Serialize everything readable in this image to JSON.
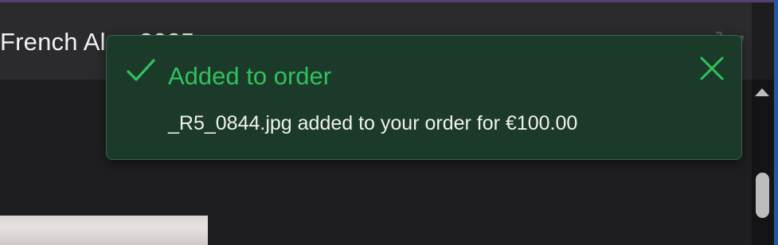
{
  "header": {
    "gallery_title": "French Alps 2025"
  },
  "icons": {
    "cart": "cart-icon",
    "check": "check-icon",
    "close": "close-icon",
    "scroll_up": "chevron-up-icon"
  },
  "toast": {
    "title": "Added to order",
    "message": "_R5_0844.jpg added to your order for €100.00",
    "accent_color": "#2fc25e",
    "background_color": "#1c3a2a"
  }
}
